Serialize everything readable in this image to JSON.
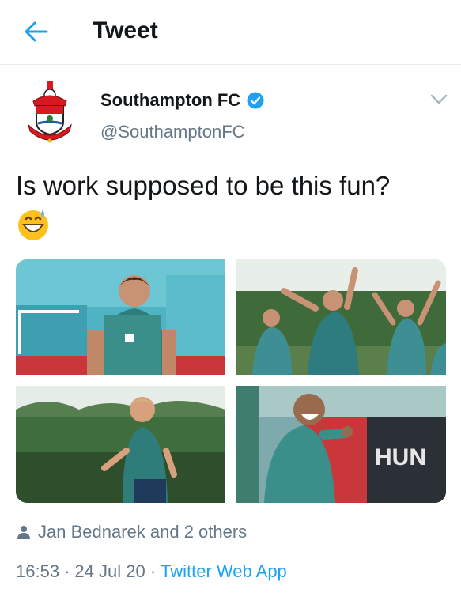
{
  "header": {
    "title": "Tweet",
    "back_icon": "arrow-left-icon"
  },
  "tweet": {
    "author_name": "Southampton FC",
    "author_handle": "@SouthamptonFC",
    "verified": true,
    "text": "Is work supposed to be this fun?",
    "emoji": "grinning-face-with-sweat",
    "photos": [
      {
        "name": "player-laughing-photo"
      },
      {
        "name": "players-celebrating-photo"
      },
      {
        "name": "player-running-photo"
      },
      {
        "name": "player-cheering-photo"
      }
    ],
    "liked_by": "Jan Bednarek and 2 others",
    "time": "16:53",
    "date": "24 Jul 20",
    "separator": "·",
    "source": "Twitter Web App"
  },
  "colors": {
    "accent": "#1da1f2",
    "muted": "#657786",
    "text": "#14171a",
    "divider": "#e6ecf0"
  }
}
